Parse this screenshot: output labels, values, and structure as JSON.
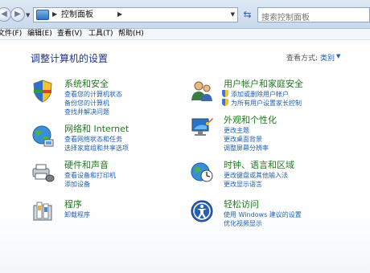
{
  "address_bar": {
    "path": "控制面板",
    "search_placeholder": "搜索控制面板"
  },
  "menu": [
    {
      "label": "文件(F)"
    },
    {
      "label": "编辑(E)"
    },
    {
      "label": "查看(V)"
    },
    {
      "label": "工具(T)"
    },
    {
      "label": "帮助(H)"
    }
  ],
  "page": {
    "title": "调整计算机的设置",
    "view_by_label": "查看方式:",
    "view_by_value": "类别"
  },
  "categories": {
    "system": {
      "title": "系统和安全",
      "links": [
        "查看您的计算机状态",
        "备份您的计算机",
        "查找并解决问题"
      ],
      "icon": "system-security-icon"
    },
    "network": {
      "title": "网络和 Internet",
      "links": [
        "查看网络状态和任务",
        "选择家庭组和共享选项"
      ],
      "icon": "network-icon"
    },
    "hardware": {
      "title": "硬件和声音",
      "links": [
        "查看设备和打印机",
        "添加设备"
      ],
      "icon": "hardware-sound-icon"
    },
    "programs": {
      "title": "程序",
      "links": [
        "卸载程序"
      ],
      "icon": "programs-icon"
    },
    "users": {
      "title": "用户帐户和家庭安全",
      "links": [
        "添加或删除用户帐户",
        "为所有用户设置家长控制"
      ],
      "icon": "users-icon"
    },
    "appearance": {
      "title": "外观和个性化",
      "links": [
        "更改主题",
        "更改桌面背景",
        "调整屏幕分辨率"
      ],
      "icon": "appearance-icon"
    },
    "clock": {
      "title": "时钟、语言和区域",
      "links": [
        "更改键盘或其他输入法",
        "更改显示语言"
      ],
      "icon": "clock-language-icon"
    },
    "ease": {
      "title": "轻松访问",
      "links": [
        "使用 Windows 建议的设置",
        "优化视频显示"
      ],
      "icon": "ease-of-access-icon"
    }
  }
}
